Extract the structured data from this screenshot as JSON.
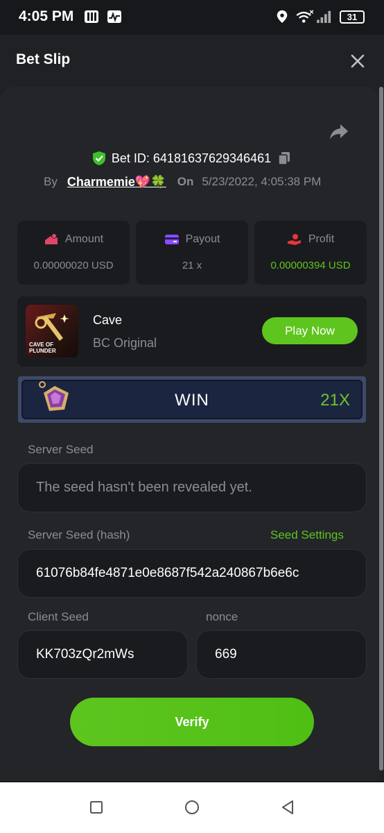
{
  "status_bar": {
    "time": "4:05 PM",
    "battery": "31"
  },
  "header": {
    "title": "Bet Slip"
  },
  "bet": {
    "id": "Bet ID: 64181637629346461",
    "by_label": "By",
    "username": "Charmemie💖🍀",
    "on_label": "On",
    "date": "5/23/2022, 4:05:38 PM"
  },
  "stats": {
    "amount_label": "Amount",
    "amount_value": "0.00000020 USD",
    "payout_label": "Payout",
    "payout_value": "21 x",
    "profit_label": "Profit",
    "profit_value": "0.00000394 USD"
  },
  "game": {
    "thumb_text": "CAVE OF PLUNDER",
    "name": "Cave",
    "provider": "BC Original",
    "play_label": "Play Now"
  },
  "result": {
    "label": "WIN",
    "multiplier": "21X"
  },
  "seeds": {
    "server_seed_label": "Server Seed",
    "server_seed_value": "The seed hasn't been revealed yet.",
    "server_hash_label": "Server Seed (hash)",
    "seed_settings_label": "Seed Settings",
    "server_hash_value": "61076b84fe4871e0e8687f542a240867b6e6c",
    "client_seed_label": "Client Seed",
    "client_seed_value": "KK703zQr2mWs",
    "nonce_label": "nonce",
    "nonce_value": "669"
  },
  "verify_label": "Verify",
  "colors": {
    "accent_green": "#5ec51f",
    "background": "#17181b",
    "card": "#1a1b1e"
  }
}
